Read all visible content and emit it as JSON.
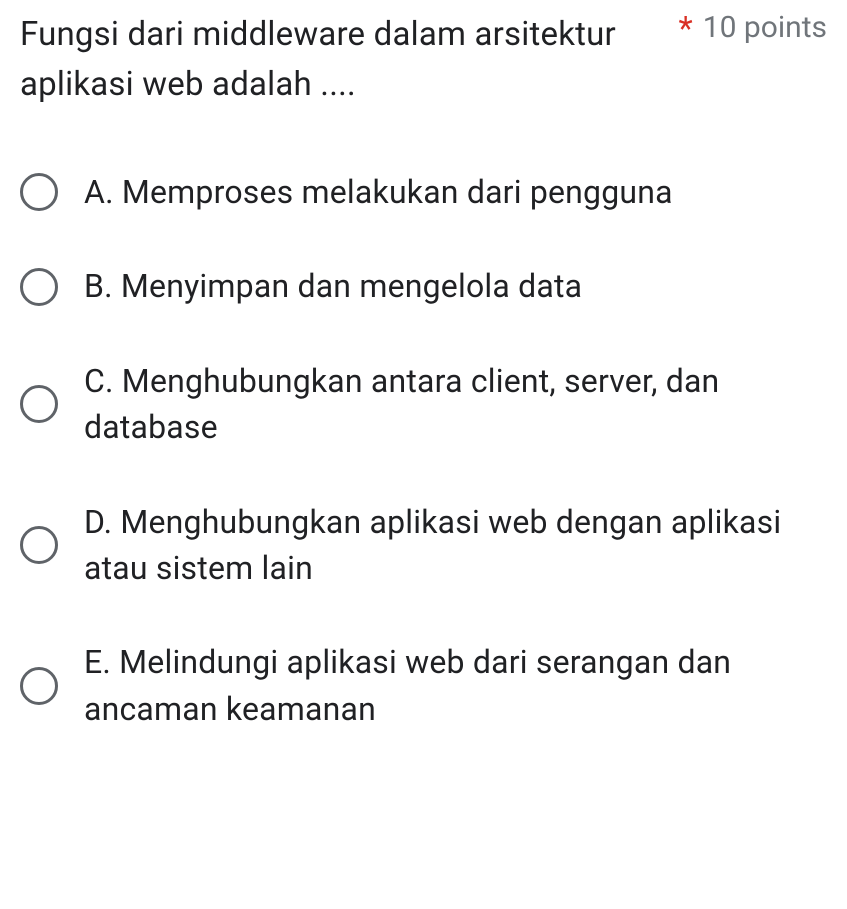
{
  "question": {
    "text": "Fungsi dari middleware dalam arsitektur aplikasi web adalah ....",
    "required_marker": "*",
    "points_label": "10 points"
  },
  "options": [
    {
      "label": "A. Memproses melakukan dari pengguna"
    },
    {
      "label": "B. Menyimpan dan mengelola data"
    },
    {
      "label": "C. Menghubungkan antara client, server, dan database"
    },
    {
      "label": "D. Menghubungkan aplikasi web dengan aplikasi atau sistem lain"
    },
    {
      "label": "E. Melindungi aplikasi web dari serangan dan ancaman keamanan"
    }
  ]
}
